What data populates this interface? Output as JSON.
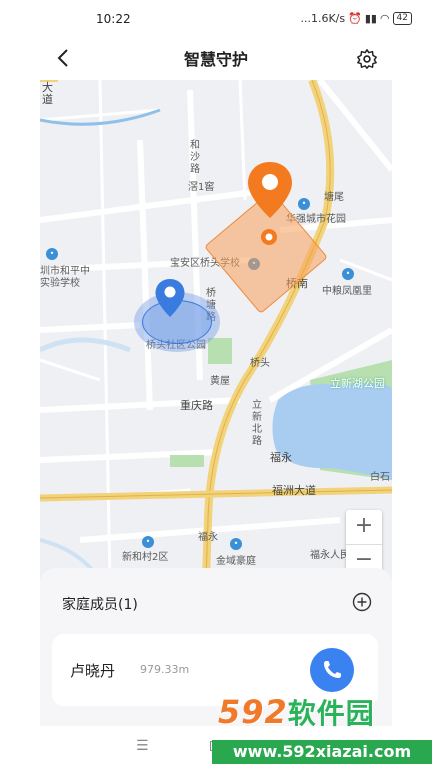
{
  "status_bar": {
    "time": "10:22",
    "network_speed": "...1.6K/s",
    "battery": "42"
  },
  "header": {
    "title": "智慧守护",
    "back_icon": "chevron-left-icon",
    "settings_icon": "gear-icon"
  },
  "map": {
    "labels": {
      "da_dao": "大\n道",
      "he_sha_lu": "和\n沙\n路",
      "xia_yi_ge": "滘1窖",
      "tang_wei": "塘尾",
      "huaqiang": "华强城市花园",
      "baoan_school": "宝安区桥头学校",
      "qiao_nan": "桥南",
      "shihe_school_1": "圳市和平中",
      "shihe_school_2": "实验学校",
      "qiaotang_lu": "桥\n塘\n路",
      "zhongliang": "中粮凤凰里",
      "qiaotou_park": "桥头社区公园",
      "qiaotou": "桥头",
      "lixin_lake_park": "立新湖公园",
      "huang_wu": "黄屋",
      "chongqing_lu": "重庆路",
      "lixin_bei_lu": "立\n新\n北\n路",
      "fu_yong": "福永",
      "fuzhou_dadao": "福洲大道",
      "bai_shi": "白石",
      "fuyong_2": "福永",
      "xinhe_village": "新和村2区",
      "jinyu_haoting": "金域豪庭",
      "fuyong_hospital": "福永人民医院"
    },
    "fences": [
      {
        "shape": "square",
        "color": "#f08a3c"
      },
      {
        "shape": "circle",
        "color": "#3a7be0"
      }
    ],
    "zoom_in": "+",
    "zoom_out": "−"
  },
  "family": {
    "title": "家庭成员(1)",
    "add_icon": "plus-circle-icon",
    "members": [
      {
        "name": "卢晓丹",
        "distance": "979.33m",
        "call_icon": "phone-icon"
      }
    ]
  },
  "nav": {
    "menu_glyph": "☰"
  },
  "watermark": {
    "logo_num": "592",
    "logo_cn": "软件园",
    "url": "www.592xiazai.com"
  },
  "colors": {
    "accent": "#3a82f0",
    "fence_orange": "#f08a3c",
    "road_yellow": "#f2d27a",
    "water": "#a9cdf0",
    "green": "#b7dfb0"
  }
}
